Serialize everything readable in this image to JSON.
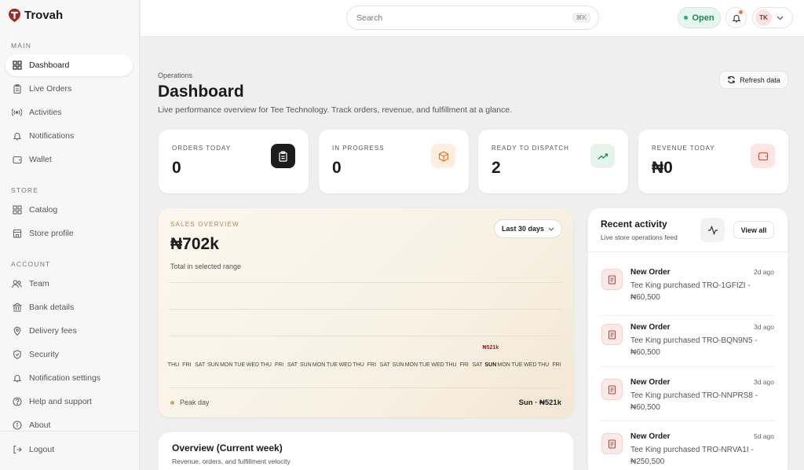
{
  "app": {
    "name": "Trovah"
  },
  "sidebar": {
    "sections": [
      {
        "title": "MAIN",
        "items": [
          {
            "label": "Dashboard",
            "icon": "grid-icon",
            "active": true
          },
          {
            "label": "Live Orders",
            "icon": "clipboard-icon"
          },
          {
            "label": "Activities",
            "icon": "broadcast-icon"
          },
          {
            "label": "Notifications",
            "icon": "bell-icon"
          },
          {
            "label": "Wallet",
            "icon": "wallet-icon"
          }
        ]
      },
      {
        "title": "STORE",
        "items": [
          {
            "label": "Catalog",
            "icon": "grid-icon"
          },
          {
            "label": "Store profile",
            "icon": "store-icon"
          }
        ]
      },
      {
        "title": "ACCOUNT",
        "items": [
          {
            "label": "Team",
            "icon": "users-icon"
          },
          {
            "label": "Bank details",
            "icon": "bank-icon"
          },
          {
            "label": "Delivery fees",
            "icon": "location-icon"
          },
          {
            "label": "Security",
            "icon": "shield-icon"
          },
          {
            "label": "Notification settings",
            "icon": "bell-icon"
          },
          {
            "label": "Help and support",
            "icon": "help-icon"
          },
          {
            "label": "About",
            "icon": "info-icon"
          }
        ]
      }
    ],
    "logout": "Logout"
  },
  "topbar": {
    "search_placeholder": "Search",
    "search_shortcut": "⌘K",
    "status": "Open",
    "user_initials": "TK"
  },
  "header": {
    "breadcrumb": "Operations",
    "title": "Dashboard",
    "subtitle": "Live performance overview for Tee Technology. Track orders, revenue, and fulfillment at a glance.",
    "refresh_label": "Refresh data"
  },
  "stats": [
    {
      "label": "ORDERS TODAY",
      "value": "0",
      "icon": "clipboard-icon"
    },
    {
      "label": "IN PROGRESS",
      "value": "0",
      "icon": "box-icon"
    },
    {
      "label": "READY TO DISPATCH",
      "value": "2",
      "icon": "trend-up-icon"
    },
    {
      "label": "REVENUE TODAY",
      "value": "₦0",
      "icon": "wallet-icon"
    }
  ],
  "sales": {
    "label": "SALES OVERVIEW",
    "total": "₦702k",
    "total_caption": "Total in selected range",
    "range": "Last 30 days",
    "peak_label": "Peak day",
    "peak_value": "Sun · ₦521k",
    "peak_marker": "₦521k"
  },
  "chart_data": {
    "type": "bar",
    "categories": [
      "THU",
      "FRI",
      "SAT",
      "SUN",
      "MON",
      "TUE",
      "WED",
      "THU",
      "FRI",
      "SAT",
      "SUN",
      "MON",
      "TUE",
      "WED",
      "THU",
      "FRI",
      "SAT",
      "SUN",
      "MON",
      "TUE",
      "WED",
      "THU",
      "FRI",
      "SAT",
      "SUN",
      "MON",
      "TUE",
      "WED",
      "THU",
      "FRI"
    ],
    "values": [
      0,
      0,
      0,
      0,
      0,
      0,
      0,
      0,
      0,
      0,
      0,
      0,
      0,
      0,
      0,
      0,
      0,
      0,
      0,
      0,
      0,
      0,
      0,
      0,
      521,
      0,
      0,
      0,
      0,
      0
    ],
    "peak_index": 24
  },
  "overview": {
    "title": "Overview (Current week)",
    "subtitle": "Revenue, orders, and fulfillment velocity"
  },
  "activity": {
    "title": "Recent activity",
    "subtitle": "Live store operations feed",
    "view_all": "View all",
    "items": [
      {
        "title": "New Order",
        "time": "2d ago",
        "desc": "Tee King purchased TRO-1GFIZI - ₦60,500"
      },
      {
        "title": "New Order",
        "time": "3d ago",
        "desc": "Tee King purchased TRO-BQN9N5 - ₦60,500"
      },
      {
        "title": "New Order",
        "time": "3d ago",
        "desc": "Tee King purchased TRO-NNPRS8 - ₦60,500"
      },
      {
        "title": "New Order",
        "time": "5d ago",
        "desc": "Tee King purchased TRO-NRVA1I - ₦250,500"
      }
    ]
  },
  "colors": {
    "brand": "#9c2b26",
    "accent_open": "#1c8a4f"
  }
}
